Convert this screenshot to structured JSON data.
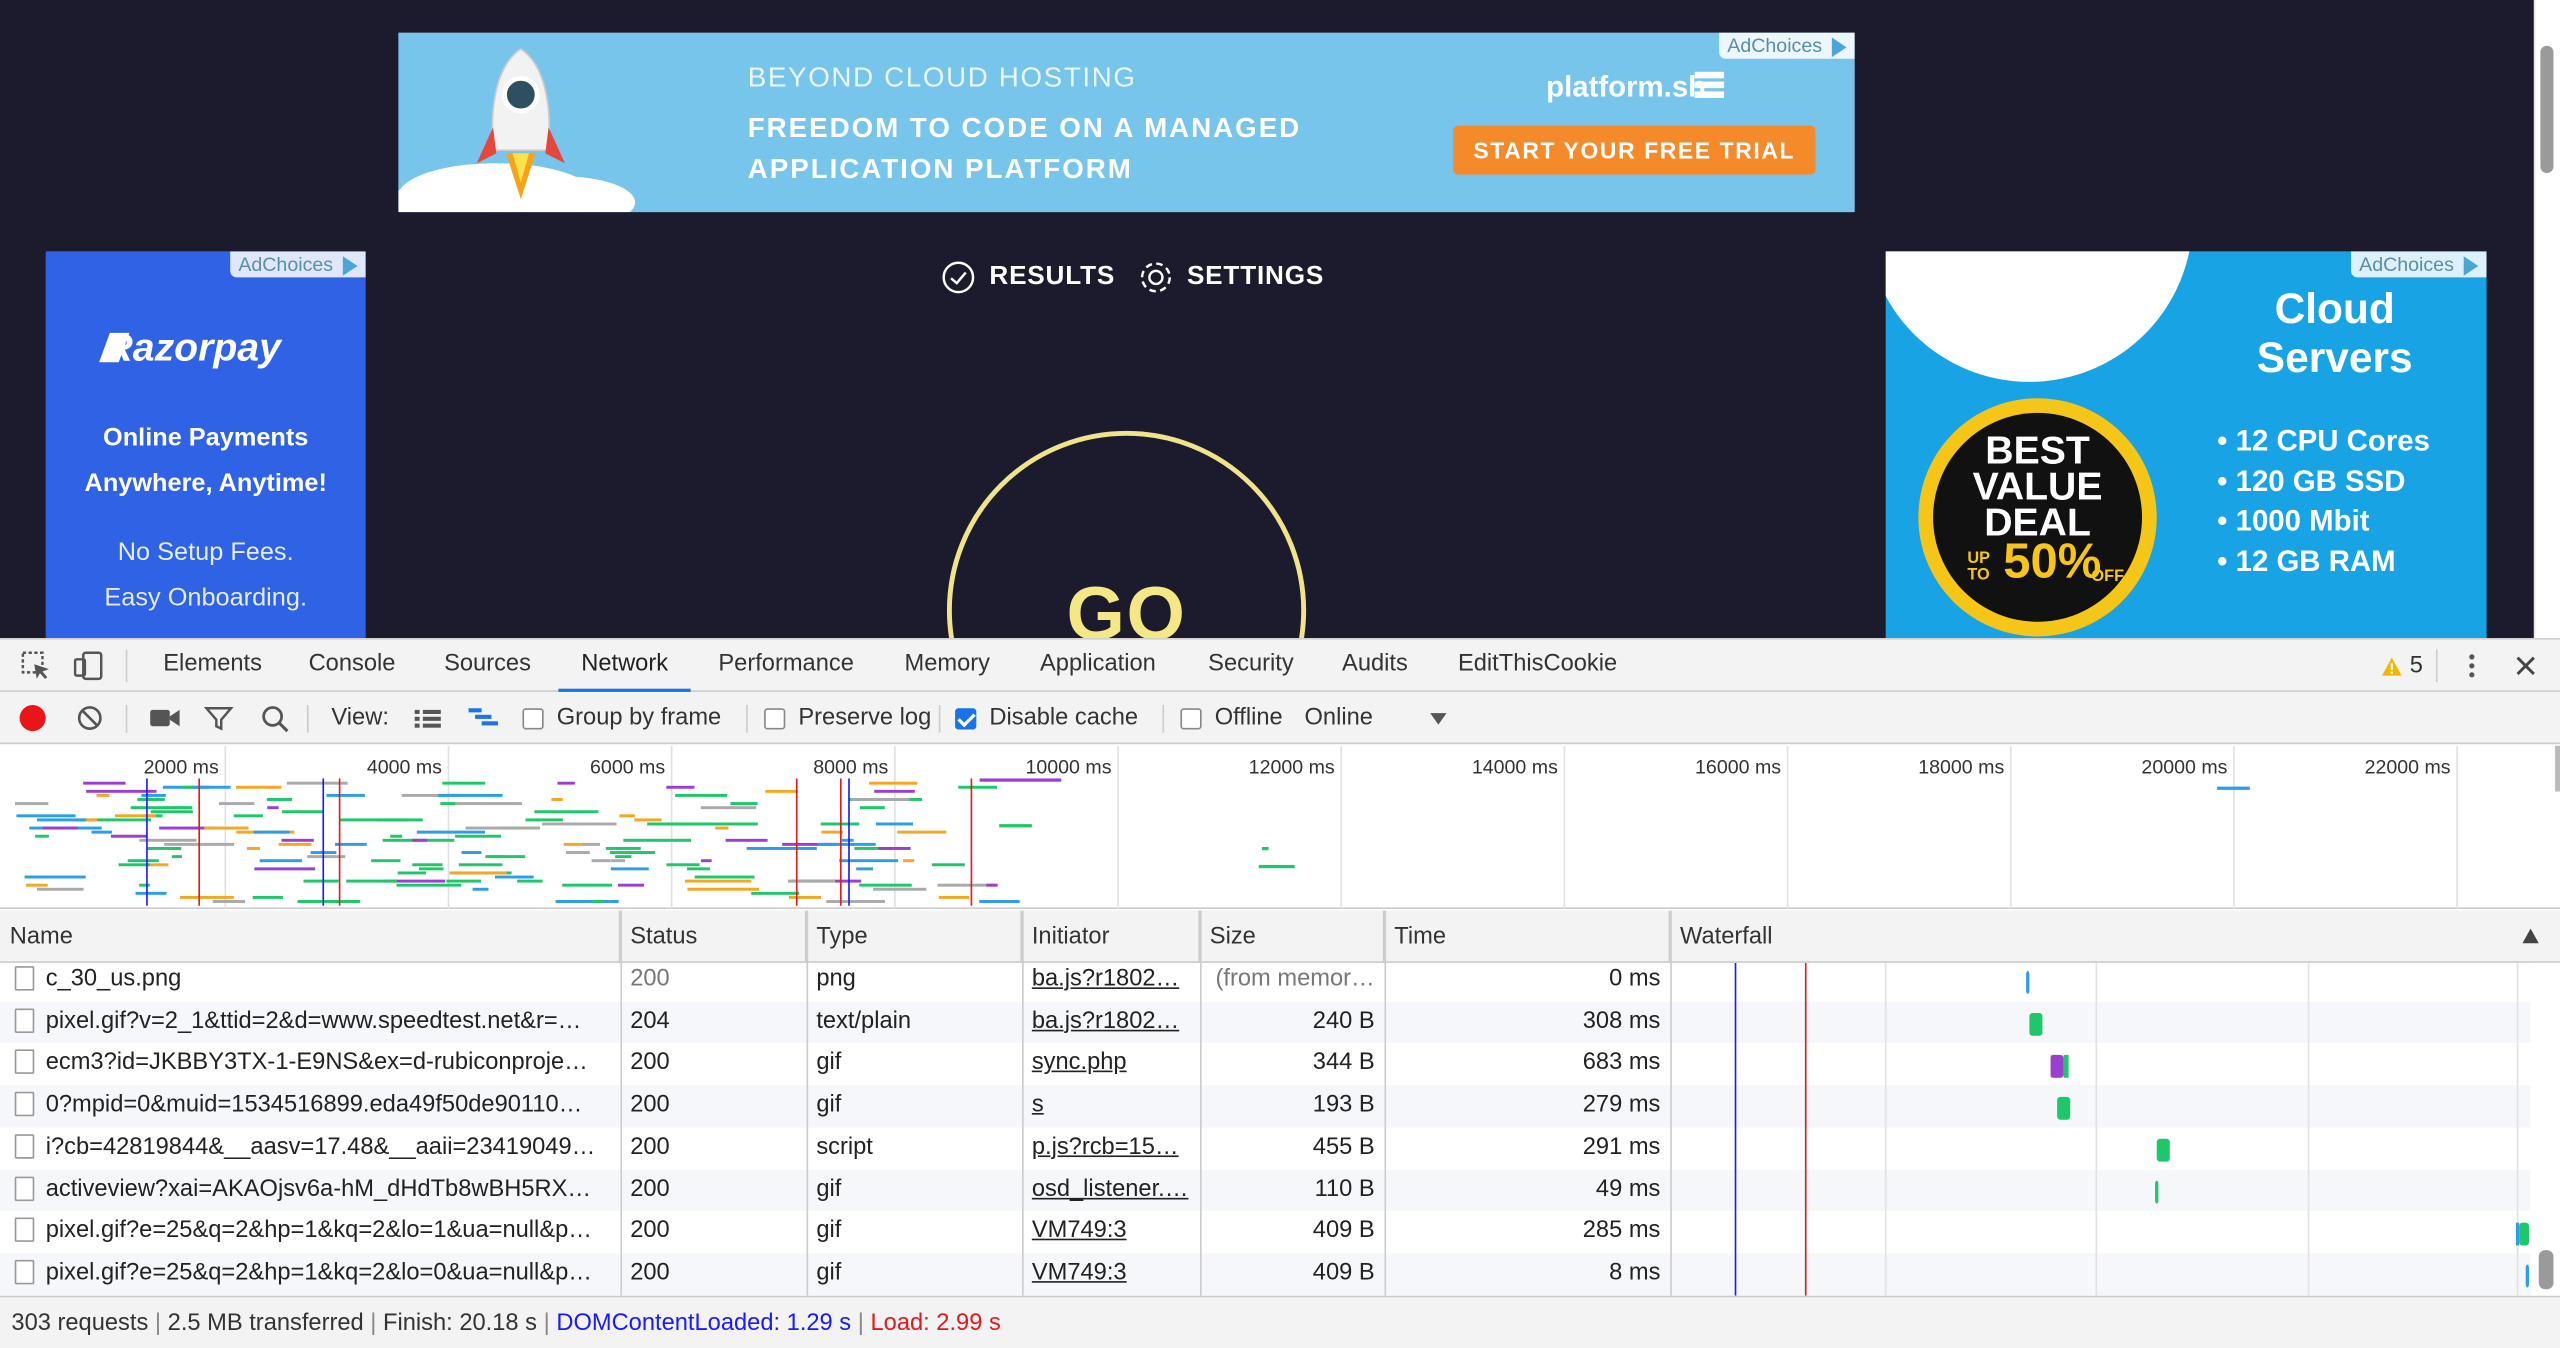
{
  "page": {
    "ad_top": {
      "kicker": "BEYOND CLOUD HOSTING",
      "line1": "FREEDOM TO CODE ON A MANAGED",
      "line2": "APPLICATION PLATFORM",
      "brand": "platform.sh",
      "cta": "START YOUR FREE TRIAL",
      "adchoices": "AdChoices"
    },
    "ad_left": {
      "brand": "Razorpay",
      "line1": "Online Payments",
      "line2": "Anywhere, Anytime!",
      "line3": "No Setup Fees.",
      "line4": "Easy Onboarding.",
      "adchoices": "AdChoices"
    },
    "ad_right": {
      "title1": "Cloud",
      "title2": "Servers",
      "badge1": "BEST",
      "badge2": "VALUE",
      "badge3": "DEAL",
      "badge_upto": "UP TO",
      "badge_pct": "50%",
      "badge_off": "OFF",
      "features": [
        "• 12 CPU Cores",
        "• 120 GB SSD",
        "• 1000 Mbit",
        "• 12 GB RAM"
      ],
      "adchoices": "AdChoices"
    },
    "nav": {
      "results": "RESULTS",
      "settings": "SETTINGS"
    },
    "go": "GO"
  },
  "devtools": {
    "tabs": [
      "Elements",
      "Console",
      "Sources",
      "Network",
      "Performance",
      "Memory",
      "Application",
      "Security",
      "Audits",
      "EditThisCookie"
    ],
    "active_tab": "Network",
    "warnings_count": "5",
    "toolbar": {
      "view_label": "View:",
      "group_by_frame": "Group by frame",
      "preserve_log": "Preserve log",
      "disable_cache": "Disable cache",
      "offline": "Offline",
      "throttle": "Online"
    },
    "checkbox_states": {
      "group_by_frame": false,
      "preserve_log": false,
      "disable_cache": true,
      "offline": false
    },
    "overview_ticks": [
      "2000 ms",
      "4000 ms",
      "6000 ms",
      "8000 ms",
      "10000 ms",
      "12000 ms",
      "14000 ms",
      "16000 ms",
      "18000 ms",
      "20000 ms",
      "22000 ms"
    ],
    "columns": [
      "Name",
      "Status",
      "Type",
      "Initiator",
      "Size",
      "Time",
      "Waterfall"
    ],
    "rows": [
      {
        "name": "c_30_us.png",
        "status": "200",
        "type": "png",
        "initiator": "ba.js?r1802…",
        "size": "(from memor…",
        "time": "0 ms"
      },
      {
        "name": "pixel.gif?v=2_1&ttid=2&d=www.speedtest.net&r=…",
        "status": "204",
        "type": "text/plain",
        "initiator": "ba.js?r1802…",
        "size": "240 B",
        "time": "308 ms"
      },
      {
        "name": "ecm3?id=JKBBY3TX-1-E9NS&ex=d-rubiconproje…",
        "status": "200",
        "type": "gif",
        "initiator": "sync.php",
        "size": "344 B",
        "time": "683 ms"
      },
      {
        "name": "0?mpid=0&muid=1534516899.eda49f50de90110…",
        "status": "200",
        "type": "gif",
        "initiator": "s",
        "size": "193 B",
        "time": "279 ms"
      },
      {
        "name": "i?cb=42819844&__aasv=17.48&__aaii=23419049…",
        "status": "200",
        "type": "script",
        "initiator": "p.js?rcb=15…",
        "size": "455 B",
        "time": "291 ms"
      },
      {
        "name": "activeview?xai=AKAOjsv6a-hM_dHdTb8wBH5RX…",
        "status": "200",
        "type": "gif",
        "initiator": "osd_listener.…",
        "size": "110 B",
        "time": "49 ms"
      },
      {
        "name": "pixel.gif?e=25&q=2&hp=1&kq=2&lo=1&ua=null&p…",
        "status": "200",
        "type": "gif",
        "initiator": "VM749:3",
        "size": "409 B",
        "time": "285 ms"
      },
      {
        "name": "pixel.gif?e=25&q=2&hp=1&kq=2&lo=0&ua=null&p…",
        "status": "200",
        "type": "gif",
        "initiator": "VM749:3",
        "size": "409 B",
        "time": "8 ms"
      }
    ],
    "status": {
      "requests": "303 requests",
      "transferred": "2.5 MB transferred",
      "finish": "Finish: 20.18 s",
      "dcl": "DOMContentLoaded: 1.29 s",
      "load": "Load: 2.99 s",
      "divider": "|"
    },
    "colors": {
      "dcl": "#1a1aff",
      "load": "#e01b1b",
      "accent": "#1a73e8",
      "record": "#e8161a",
      "waterfall_green": "#1ec76a",
      "waterfall_purple": "#9b3fd3",
      "waterfall_orange": "#f5a623"
    }
  }
}
